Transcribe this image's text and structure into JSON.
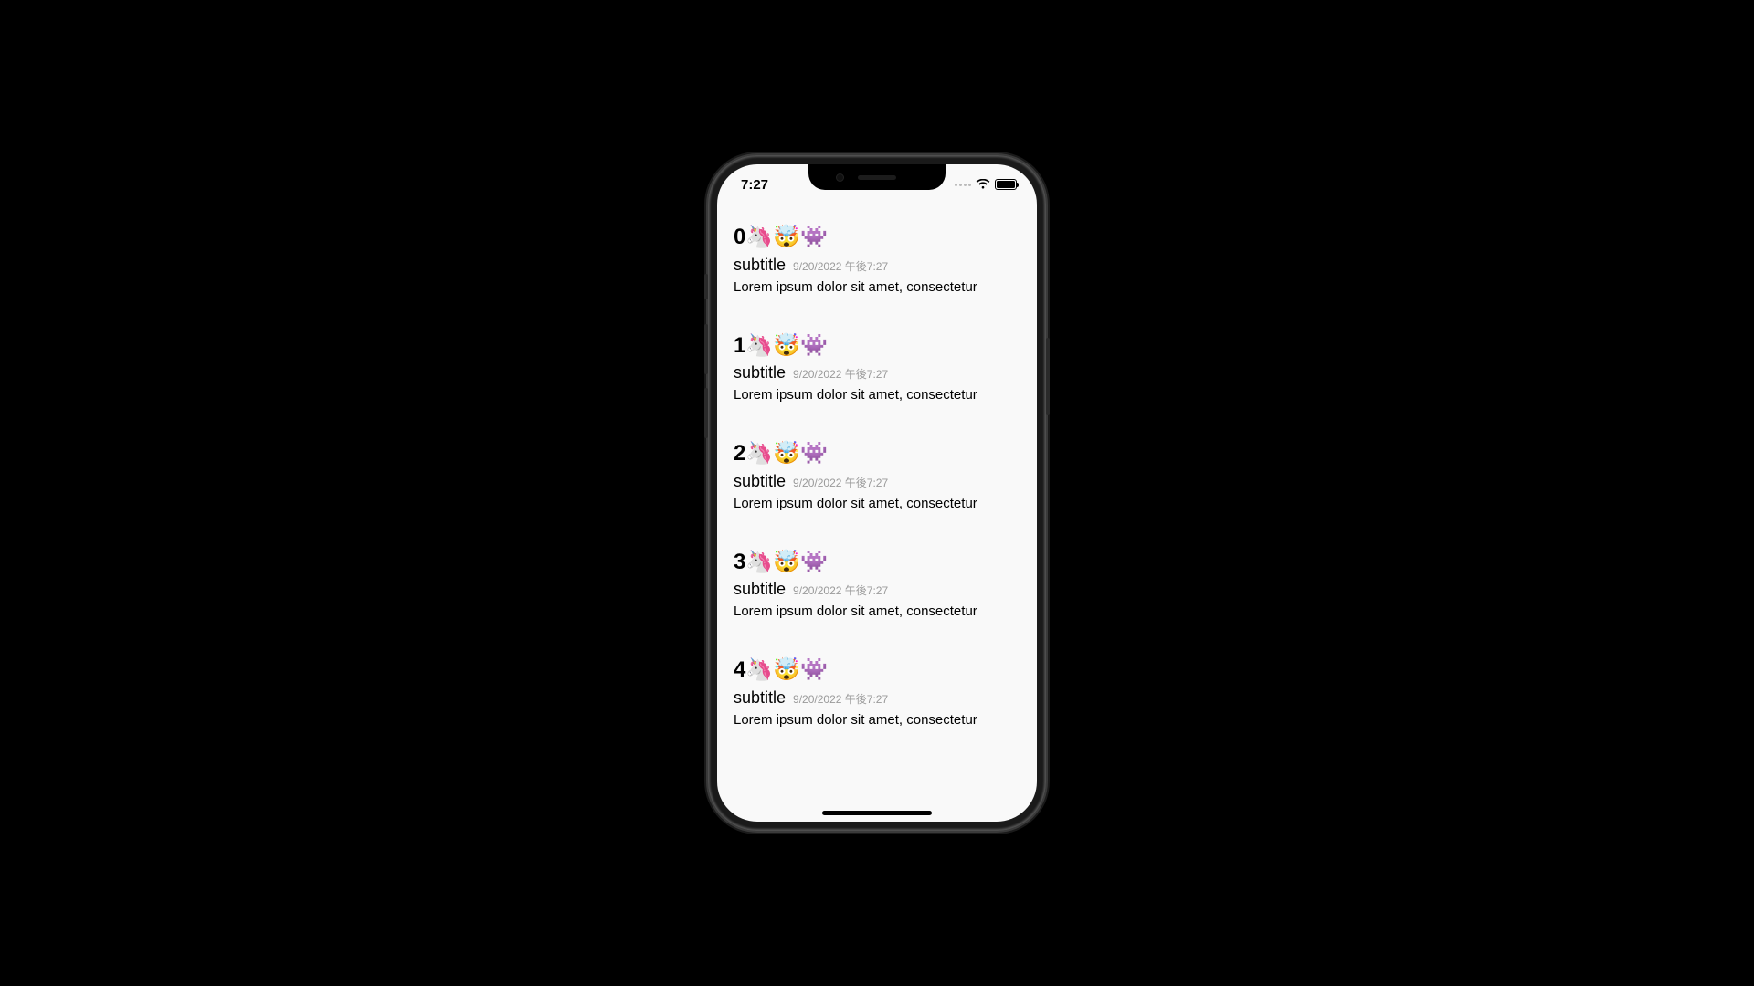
{
  "status": {
    "time": "7:27"
  },
  "items": [
    {
      "title": "0🦄🤯👾",
      "subtitle": "subtitle",
      "date": "9/20/2022 午後7:27",
      "body": "Lorem ipsum dolor sit amet, consectetur"
    },
    {
      "title": "1🦄🤯👾",
      "subtitle": "subtitle",
      "date": "9/20/2022 午後7:27",
      "body": "Lorem ipsum dolor sit amet, consectetur"
    },
    {
      "title": "2🦄🤯👾",
      "subtitle": "subtitle",
      "date": "9/20/2022 午後7:27",
      "body": "Lorem ipsum dolor sit amet, consectetur"
    },
    {
      "title": "3🦄🤯👾",
      "subtitle": "subtitle",
      "date": "9/20/2022 午後7:27",
      "body": "Lorem ipsum dolor sit amet, consectetur"
    },
    {
      "title": "4🦄🤯👾",
      "subtitle": "subtitle",
      "date": "9/20/2022 午後7:27",
      "body": "Lorem ipsum dolor sit amet, consectetur"
    }
  ]
}
